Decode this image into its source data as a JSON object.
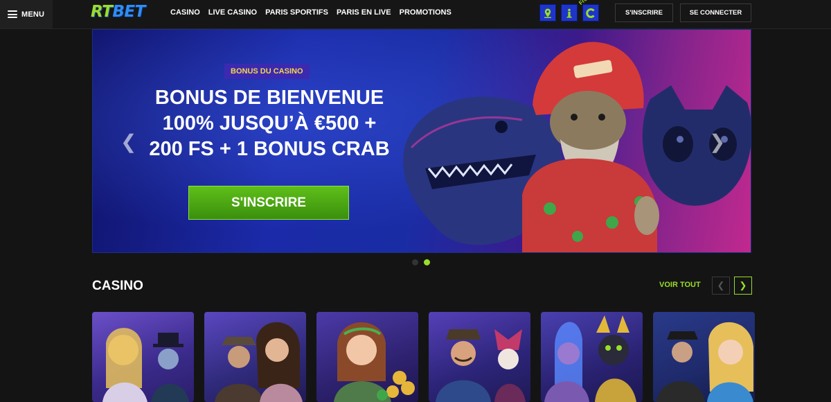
{
  "header": {
    "menu_label": "MENU",
    "logo_rt": "RT",
    "logo_bet": "BET",
    "nav": [
      "CASINO",
      "LIVE CASINO",
      "PARIS SPORTIFS",
      "PARIS EN LIVE",
      "PROMOTIONS"
    ],
    "free_label": "Free",
    "signup_label": "S'INSCRIRE",
    "login_label": "SE CONNECTER",
    "icons": [
      "location-icon",
      "info-icon",
      "free-spin-icon"
    ]
  },
  "hero": {
    "badge": "BONUS DU CASINO",
    "title_lines": [
      "BONUS DE BIENVENUE",
      "100% JUSQU’À €500 +",
      "200 FS + 1 BONUS CRAB"
    ],
    "cta_label": "S'INSCRIRE",
    "slides": 2,
    "active_slide": 2
  },
  "casino": {
    "title": "CASINO",
    "see_all": "VOIR TOUT",
    "games": [
      "game-1",
      "game-2",
      "game-3",
      "game-4",
      "game-5",
      "game-6"
    ]
  },
  "colors": {
    "accent_green": "#9ade2a",
    "accent_blue": "#1f35c9",
    "badge_yellow": "#f7d64a"
  }
}
